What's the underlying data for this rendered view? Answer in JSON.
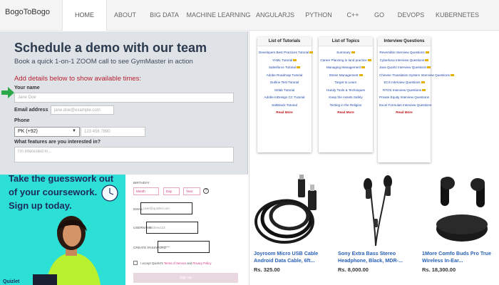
{
  "nav": {
    "brand": "BogoToBogo",
    "items": [
      {
        "label": "HOME",
        "active": true,
        "width": 63
      },
      {
        "label": "ABOUT",
        "active": false,
        "width": 51
      },
      {
        "label": "BIG DATA",
        "active": false,
        "width": 59
      },
      {
        "label": "MACHINE LEARNING",
        "active": false,
        "width": 93
      },
      {
        "label": "ANGULARJS",
        "active": false,
        "width": 66
      },
      {
        "label": "PYTHON",
        "active": false,
        "width": 56
      },
      {
        "label": "C++",
        "active": false,
        "width": 40
      },
      {
        "label": "GO",
        "active": false,
        "width": 34
      },
      {
        "label": "DEVOPS",
        "active": false,
        "width": 55
      },
      {
        "label": "KUBERNETES",
        "active": false,
        "width": 75
      }
    ]
  },
  "demo": {
    "title": "Schedule a demo with our team",
    "subtitle": "Book a quick 1-on-1 ZOOM call to see GymMaster in action",
    "add_details": "Add details below to show available times:",
    "name_label": "Your name",
    "name_placeholder": "Jane Doe",
    "email_label": "Email address",
    "email_placeholder": "jane.doe@example.com",
    "phone_label": "Phone",
    "country_code": "PK (+92)",
    "phone_placeholder": "123 456 7890",
    "interest_label": "What features are you interested in?",
    "interest_placeholder": "I'm interested in..."
  },
  "cards": [
    {
      "title": "List of Tutorials",
      "links": [
        "Developers Best Practices Tutorial",
        "YAML Tutorial",
        "Salesforce Tutorial",
        "Adobe Roadmap Tutorial",
        "Outline Test Tutorial",
        "Gitlab Tutorial",
        "Adobe InDesign CC Tutorial",
        "SaltStack Tutorial"
      ],
      "badges": [
        0,
        1,
        2
      ],
      "more": "Read More"
    },
    {
      "title": "List of Topics",
      "links": [
        "Summary",
        "Career Planning in land practice",
        "Managing Management",
        "Stress Management",
        "Target to Learn",
        "Handy Tools & Techniques",
        "Keep the Assets Safely",
        "Testing in the Religion"
      ],
      "badges": [
        0,
        1,
        2,
        3
      ],
      "more": "Read More"
    },
    {
      "title": "Interview Questions",
      "links": [
        "Reversible Interview Questions",
        "Cyberluna Interview Questions",
        "Java Quartz Interview Questions",
        "Chinese Translation System Interview Questions",
        "ECS Interview Questions",
        "RTOS Interview Questions",
        "Private Equity Interview Questions",
        "Excel Formulas Interview Questions"
      ],
      "badges": [
        0,
        1,
        2,
        3,
        4,
        5
      ],
      "more": "Read More"
    }
  ],
  "quizlet": {
    "headline_lines": [
      "Take the guesswork out",
      "of your coursework.",
      "Sign up today."
    ],
    "logo": "Quizlet"
  },
  "signup": {
    "birthday_label": "BIRTHDAY",
    "month": "Month",
    "day": "Day",
    "year": "Year",
    "help": "?",
    "email_label": "EMAIL",
    "email_placeholder": "user@quizlet.com",
    "username_label": "USERNAME",
    "username_placeholder": "andrew123",
    "password_label": "CREATE PASSWORD",
    "password_placeholder": "••••••••",
    "terms_prefix": "I accept Quizlet's",
    "terms_link": "Terms of Service",
    "terms_mid": "and",
    "privacy_link": "Privacy Policy",
    "button": "Sign up"
  },
  "products": [
    {
      "name": "Joyroom Micro USB Cable Android Data Cable, 6ft...",
      "price": "Rs. 325.00"
    },
    {
      "name": "Sony Extra Bass Stereo Headphone, Black, MDR-...",
      "price": "Rs. 8,000.00"
    },
    {
      "name": "1More Comfo Buds Pro True Wireless In-Ear...",
      "price": "Rs. 18,300.00"
    }
  ],
  "colors": {
    "title": "#2b3a4d",
    "add_details": "#b81e2d",
    "arrow": "#2aa84a",
    "link": "#1f47a8",
    "quiz_bg": "#2de0d6",
    "product_link": "#2a62b6"
  }
}
